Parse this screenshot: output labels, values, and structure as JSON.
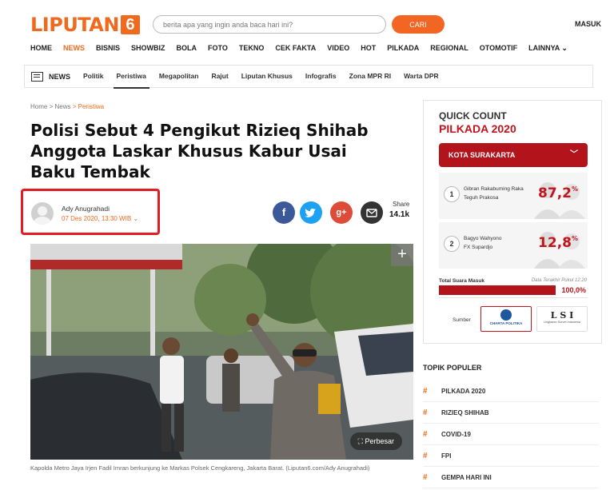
{
  "header": {
    "logo_text": "LIPUTAN",
    "logo_number": "6",
    "search_placeholder": "berita apa yang ingin anda baca hari ini?",
    "search_button": "CARI",
    "login": "MASUK",
    "accent_color": "#f06a1d"
  },
  "main_nav": [
    {
      "label": "HOME",
      "active": false
    },
    {
      "label": "NEWS",
      "active": true
    },
    {
      "label": "BISNIS",
      "active": false
    },
    {
      "label": "SHOWBIZ",
      "active": false
    },
    {
      "label": "BOLA",
      "active": false
    },
    {
      "label": "FOTO",
      "active": false
    },
    {
      "label": "TEKNO",
      "active": false
    },
    {
      "label": "CEK FAKTA",
      "active": false
    },
    {
      "label": "VIDEO",
      "active": false
    },
    {
      "label": "HOT",
      "active": false
    },
    {
      "label": "PILKADA",
      "active": false
    },
    {
      "label": "REGIONAL",
      "active": false
    },
    {
      "label": "OTOMOTIF",
      "active": false
    },
    {
      "label": "LAINNYA ⌄",
      "active": false
    }
  ],
  "sub_nav": {
    "section_label": "NEWS",
    "items": [
      {
        "label": "Politik",
        "active": false
      },
      {
        "label": "Peristiwa",
        "active": true
      },
      {
        "label": "Megapolitan",
        "active": false
      },
      {
        "label": "Rajut",
        "active": false
      },
      {
        "label": "Liputan Khusus",
        "active": false
      },
      {
        "label": "Infografis",
        "active": false
      },
      {
        "label": "Zona MPR RI",
        "active": false
      },
      {
        "label": "Warta DPR",
        "active": false
      }
    ]
  },
  "breadcrumb": {
    "home": "Home",
    "sep": ">",
    "section": "News",
    "current": "Peristiwa"
  },
  "article": {
    "title": "Polisi Sebut 4 Pengikut Rizieq Shihab Anggota Laskar Khusus Kabur Usai Baku Tembak",
    "author": "Ady Anugrahadi",
    "date": "07 Des 2020, 13:30 WIB ⌄",
    "photo_button": "Perbesar",
    "caption": "Kapolda Metro Jaya Irjen Fadil Imran berkunjung ke Markas Polsek Cengkareng, Jakarta Barat. (Liputan6.com/Ady Anugrahadi)"
  },
  "share": {
    "label": "Share",
    "count": "14.1k",
    "fb_icon": "f",
    "tw_icon": "✉",
    "gp_icon": "g+",
    "email_icon": "✉"
  },
  "quick_count": {
    "title_line1": "QUICK COUNT",
    "title_line2": "PILKADA 2020",
    "region": "KOTA SURAKARTA",
    "candidates": [
      {
        "number": "1",
        "name1": "Gibran Rakabuming Raka",
        "name2": "Teguh Prakosa",
        "percent": "87,2",
        "sign": "%"
      },
      {
        "number": "2",
        "name1": "Bagyo Wahyono",
        "name2": "FX Supardjo",
        "percent": "12,8",
        "sign": "%"
      }
    ],
    "total_label": "Total Suara Masuk",
    "last_update": "Data Terakhir Pukul 12.20",
    "total_percent": "100,0%",
    "total_fraction": 1.0,
    "source_label": "Sumber",
    "source1": "CHARTA POLITIKA",
    "source2_logo": "L S I",
    "source2_sub": "Lingkaran Survei Indonesia",
    "brand_red": "#b3131b"
  },
  "topik_populer": {
    "title": "TOPIK POPULER",
    "items": [
      {
        "hash": "#",
        "label": "PILKADA 2020"
      },
      {
        "hash": "#",
        "label": "RIZIEQ SHIHAB"
      },
      {
        "hash": "#",
        "label": "COVID-19"
      },
      {
        "hash": "#",
        "label": "FPI"
      },
      {
        "hash": "#",
        "label": "GEMPA HARI INI"
      }
    ]
  }
}
